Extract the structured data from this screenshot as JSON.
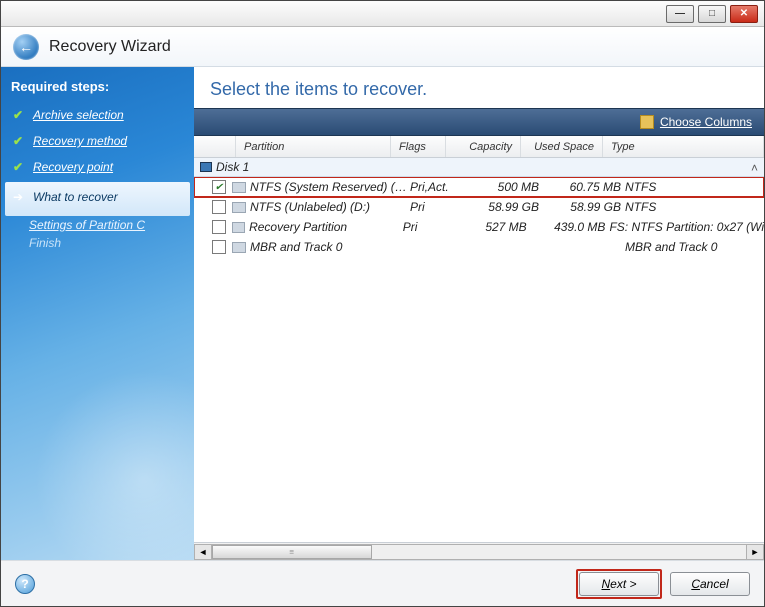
{
  "app_title": "Recovery Wizard",
  "sidebar": {
    "heading": "Required steps:",
    "steps": [
      {
        "label": "Archive selection",
        "done": true
      },
      {
        "label": "Recovery method",
        "done": true
      },
      {
        "label": "Recovery point",
        "done": true
      }
    ],
    "current": "What to recover",
    "sub": "Settings of Partition C",
    "pending": "Finish"
  },
  "main": {
    "instruction": "Select the items to recover.",
    "toolbar_link": "Choose Columns"
  },
  "columns": {
    "partition": "Partition",
    "flags": "Flags",
    "capacity": "Capacity",
    "used": "Used Space",
    "type": "Type"
  },
  "disk_label": "Disk 1",
  "rows": [
    {
      "checked": true,
      "name": "NTFS (System Reserved) (C:)",
      "flags": "Pri,Act.",
      "cap": "500 MB",
      "used": "60.75 MB",
      "type": "NTFS"
    },
    {
      "checked": false,
      "name": "NTFS (Unlabeled) (D:)",
      "flags": "Pri",
      "cap": "58.99 GB",
      "used": "58.99 GB",
      "type": "NTFS"
    },
    {
      "checked": false,
      "name": "Recovery Partition",
      "flags": "Pri",
      "cap": "527 MB",
      "used": "439.0 MB",
      "type": "FS: NTFS Partition: 0x27 (Wi"
    },
    {
      "checked": false,
      "name": "MBR and Track 0",
      "flags": "",
      "cap": "",
      "used": "",
      "type": "MBR and Track 0"
    }
  ],
  "footer": {
    "next": "Next >",
    "cancel": "Cancel"
  }
}
